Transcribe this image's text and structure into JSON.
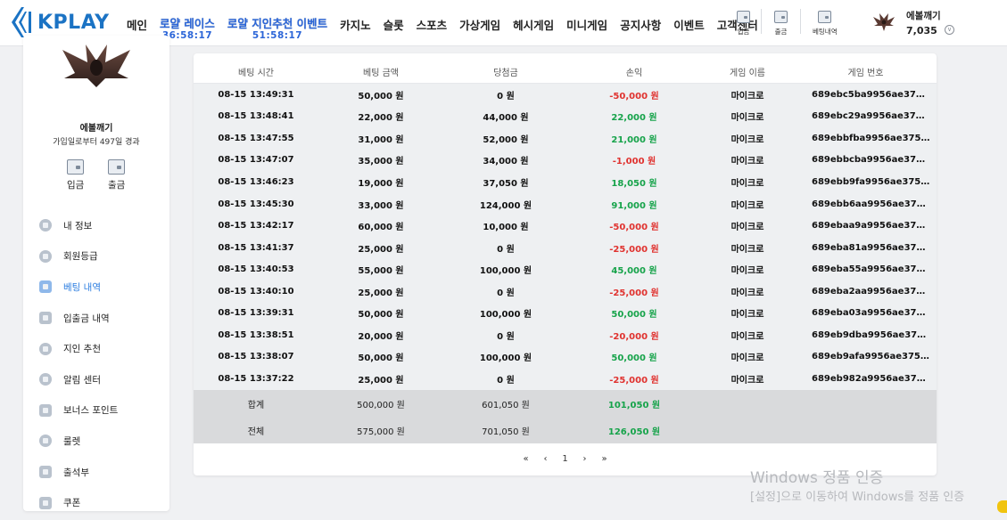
{
  "header": {
    "logo_text": "KPLAY",
    "nav": [
      {
        "label": "메인"
      },
      {
        "label": "로얄 레이스",
        "timer": "36:58:17",
        "event": true
      },
      {
        "label": "로얄 지인추천 이벤트",
        "timer": "51:58:17",
        "event": true
      },
      {
        "label": "카지노"
      },
      {
        "label": "슬롯"
      },
      {
        "label": "스포츠"
      },
      {
        "label": "가상게임"
      },
      {
        "label": "헤시게임"
      },
      {
        "label": "미니게임"
      },
      {
        "label": "공지사항"
      },
      {
        "label": "이벤트"
      },
      {
        "label": "고객센터"
      }
    ],
    "quick": {
      "deposit": "입금",
      "withdraw": "출금",
      "betting": "베팅내역"
    },
    "user": {
      "nickname": "에볼깨기",
      "balance": "7,035"
    }
  },
  "sidebar": {
    "nickname": "에볼깨기",
    "joined": "가입일로부터 497일 경과",
    "deposit": "입금",
    "withdraw": "출금",
    "menu": [
      {
        "label": "내 정보",
        "icon": "profile-icon"
      },
      {
        "label": "회원등급",
        "icon": "grade-icon"
      },
      {
        "label": "베팅 내역",
        "icon": "betting-history-icon",
        "active": true
      },
      {
        "label": "입출금 내역",
        "icon": "transactions-icon"
      },
      {
        "label": "지인 추천",
        "icon": "referral-icon"
      },
      {
        "label": "알림 센터",
        "icon": "notification-icon"
      },
      {
        "label": "보너스 포인트",
        "icon": "bonus-point-icon"
      },
      {
        "label": "룰렛",
        "icon": "roulette-icon"
      },
      {
        "label": "출석부",
        "icon": "attendance-icon"
      },
      {
        "label": "쿠폰",
        "icon": "coupon-icon"
      }
    ]
  },
  "table": {
    "headers": [
      "베팅 시간",
      "베팅 금액",
      "당첨금",
      "손익",
      "게임 이름",
      "게임 번호"
    ],
    "rows": [
      {
        "time": "08-15 13:49:31",
        "bet": "50,000 원",
        "win": "0 원",
        "pl": "-50,000 원",
        "game": "마이크로",
        "id": "689ebc5ba9956ae37…"
      },
      {
        "time": "08-15 13:48:41",
        "bet": "22,000 원",
        "win": "44,000 원",
        "pl": "22,000 원",
        "game": "마이크로",
        "id": "689ebc29a9956ae37…"
      },
      {
        "time": "08-15 13:47:55",
        "bet": "31,000 원",
        "win": "52,000 원",
        "pl": "21,000 원",
        "game": "마이크로",
        "id": "689ebbfba9956ae375…"
      },
      {
        "time": "08-15 13:47:07",
        "bet": "35,000 원",
        "win": "34,000 원",
        "pl": "-1,000 원",
        "game": "마이크로",
        "id": "689ebbcba9956ae37…"
      },
      {
        "time": "08-15 13:46:23",
        "bet": "19,000 원",
        "win": "37,050 원",
        "pl": "18,050 원",
        "game": "마이크로",
        "id": "689ebb9fa9956ae375…"
      },
      {
        "time": "08-15 13:45:30",
        "bet": "33,000 원",
        "win": "124,000 원",
        "pl": "91,000 원",
        "game": "마이크로",
        "id": "689ebb6aa9956ae37…"
      },
      {
        "time": "08-15 13:42:17",
        "bet": "60,000 원",
        "win": "10,000 원",
        "pl": "-50,000 원",
        "game": "마이크로",
        "id": "689ebaa9a9956ae37…"
      },
      {
        "time": "08-15 13:41:37",
        "bet": "25,000 원",
        "win": "0 원",
        "pl": "-25,000 원",
        "game": "마이크로",
        "id": "689eba81a9956ae37…"
      },
      {
        "time": "08-15 13:40:53",
        "bet": "55,000 원",
        "win": "100,000 원",
        "pl": "45,000 원",
        "game": "마이크로",
        "id": "689eba55a9956ae37…"
      },
      {
        "time": "08-15 13:40:10",
        "bet": "25,000 원",
        "win": "0 원",
        "pl": "-25,000 원",
        "game": "마이크로",
        "id": "689eba2aa9956ae37…"
      },
      {
        "time": "08-15 13:39:31",
        "bet": "50,000 원",
        "win": "100,000 원",
        "pl": "50,000 원",
        "game": "마이크로",
        "id": "689eba03a9956ae37…"
      },
      {
        "time": "08-15 13:38:51",
        "bet": "20,000 원",
        "win": "0 원",
        "pl": "-20,000 원",
        "game": "마이크로",
        "id": "689eb9dba9956ae37…"
      },
      {
        "time": "08-15 13:38:07",
        "bet": "50,000 원",
        "win": "100,000 원",
        "pl": "50,000 원",
        "game": "마이크로",
        "id": "689eb9afa9956ae375…"
      },
      {
        "time": "08-15 13:37:22",
        "bet": "25,000 원",
        "win": "0 원",
        "pl": "-25,000 원",
        "game": "마이크로",
        "id": "689eb982a9956ae37…"
      }
    ],
    "totals": [
      {
        "label": "합계",
        "bet": "500,000 원",
        "win": "601,050 원",
        "pl": "101,050 원"
      },
      {
        "label": "전체",
        "bet": "575,000 원",
        "win": "701,050 원",
        "pl": "126,050 원"
      }
    ],
    "pager": {
      "first": "«",
      "prev": "‹",
      "page": "1",
      "next": "›",
      "last": "»"
    }
  },
  "watermark": {
    "line1": "Windows 정품 인증",
    "line2": "[설정]으로 이동하여 Windows를 정품 인증"
  },
  "colors": {
    "brand": "#1b73c4",
    "event": "#2b65d8",
    "loss": "#e0322f",
    "gain": "#16a34a",
    "active_menu": "#2b7de0"
  }
}
